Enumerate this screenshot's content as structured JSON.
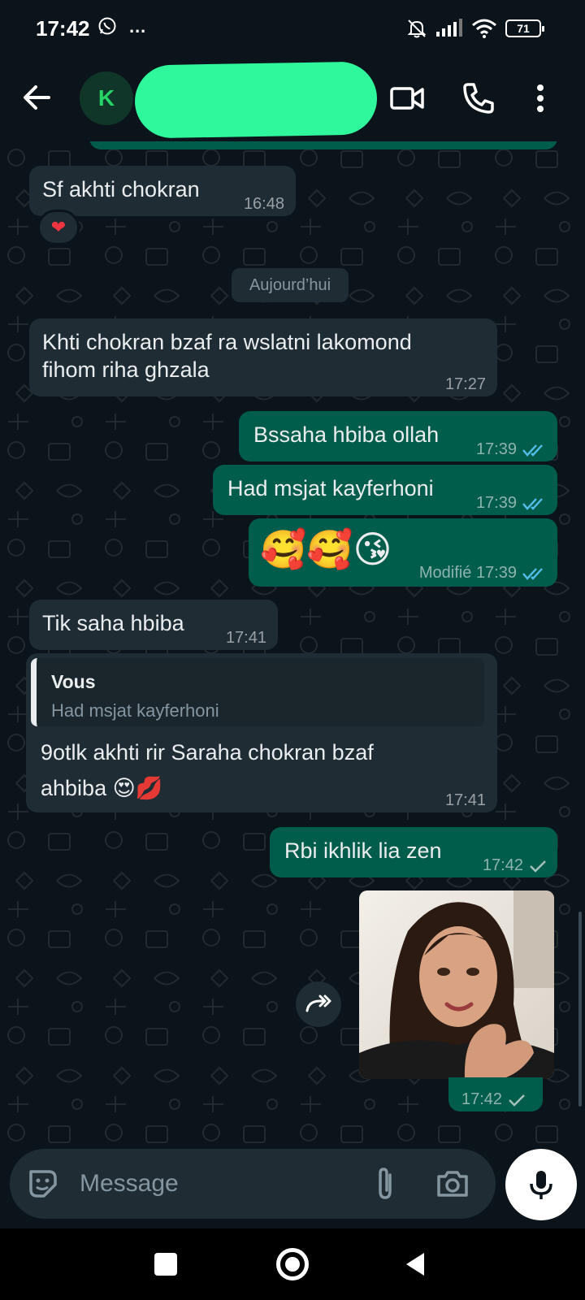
{
  "status_bar": {
    "time": "17:42",
    "left_icons": "…",
    "battery": "71"
  },
  "header": {
    "avatar_letter": "K"
  },
  "colors": {
    "incoming_bubble": "#1f2c34",
    "outgoing_bubble": "#005c4b",
    "read_ticks": "#53bdeb",
    "name_redaction": "#2ff79c"
  },
  "chat": {
    "prev_message_time": "16:48",
    "msg1": {
      "text": "Sf akhti chokran",
      "time": "16:48",
      "reaction": "❤"
    },
    "day_separator": "Aujourd’hui",
    "msg2": {
      "text": "Khti chokran bzaf ra wslatni lakomond fihom riha ghzala",
      "time": "17:27"
    },
    "msg3": {
      "text": "Bssaha hbiba ollah",
      "time": "17:39",
      "status": "read"
    },
    "msg4": {
      "text": "Had msjat kayferhoni",
      "time": "17:39",
      "status": "read"
    },
    "msg5": {
      "emojis": "🥰🥰😘",
      "edited_label": "Modifié",
      "time": "17:39",
      "status": "read"
    },
    "msg6": {
      "text": "Tik saha hbiba",
      "time": "17:41"
    },
    "msg7": {
      "quote_author": "Vous",
      "quote_text": "Had msjat kayferhoni",
      "text": "9otlk akhti rir Saraha chokran bzaf ahbiba 😍💋",
      "time": "17:41"
    },
    "msg8": {
      "text": "Rbi ikhlik lia zen",
      "time": "17:42",
      "status": "sent"
    },
    "msg9": {
      "type": "photo",
      "time": "17:42",
      "status": "sent"
    }
  },
  "composer": {
    "placeholder": "Message"
  }
}
